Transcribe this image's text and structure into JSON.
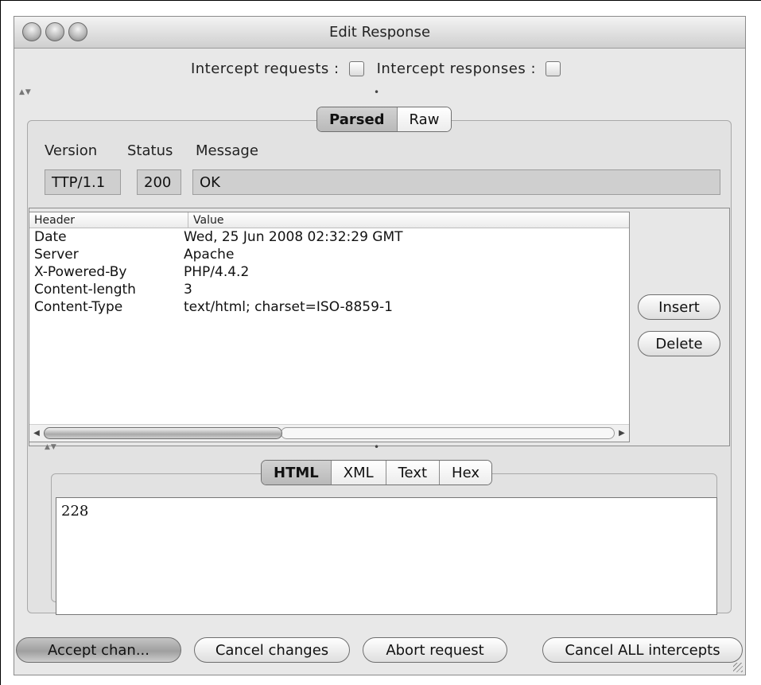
{
  "window": {
    "title": "Edit Response"
  },
  "intercept": {
    "requests_label": "Intercept requests :",
    "responses_label": "Intercept responses :",
    "requests_checked": false,
    "responses_checked": false
  },
  "view_tabs": [
    "Parsed",
    "Raw"
  ],
  "view_selected": "Parsed",
  "status_line": {
    "version_label": "Version",
    "status_label": "Status",
    "message_label": "Message",
    "version": "TTP/1.1",
    "status": "200",
    "message": "OK"
  },
  "headers_table": {
    "columns": [
      "Header",
      "Value"
    ],
    "rows": [
      {
        "header": "Date",
        "value": "Wed, 25 Jun 2008 02:32:29 GMT"
      },
      {
        "header": "Server",
        "value": "Apache"
      },
      {
        "header": "X-Powered-By",
        "value": "PHP/4.4.2"
      },
      {
        "header": "Content-length",
        "value": "3"
      },
      {
        "header": "Content-Type",
        "value": "text/html; charset=ISO-8859-1"
      }
    ]
  },
  "table_buttons": {
    "insert": "Insert",
    "delete": "Delete"
  },
  "body_tabs": [
    "HTML",
    "XML",
    "Text",
    "Hex"
  ],
  "body_selected": "HTML",
  "body_content": "228",
  "footer_buttons": {
    "accept": "Accept chan...",
    "cancel_changes": "Cancel changes",
    "abort": "Abort request",
    "cancel_all": "Cancel ALL intercepts"
  }
}
